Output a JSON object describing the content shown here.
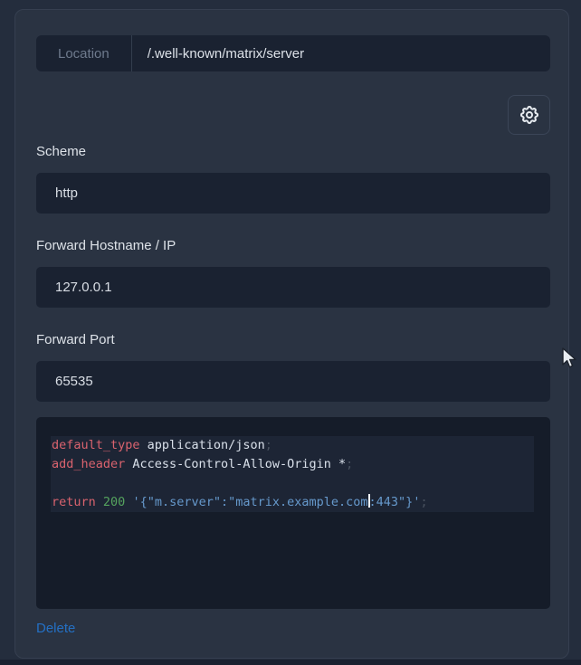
{
  "theme": {
    "page_bg": "#242d3d",
    "card_bg": "#2a3342",
    "input_bg": "#1a2231",
    "link_blue": "#2470c4",
    "code_bg": "#151c29",
    "code_line_bg": "#1d2535",
    "code_keyword_color": "#da636e",
    "code_number_color": "#55a35e",
    "code_string_color": "#6699cc",
    "code_punct_color": "#49525f"
  },
  "location_field": {
    "prefix": "Location",
    "value": "/.well-known/matrix/server"
  },
  "settings_button": {
    "icon": "gear-icon"
  },
  "fields": [
    {
      "label": "Scheme",
      "value": "http"
    },
    {
      "label": "Forward Hostname / IP",
      "value": "127.0.0.1"
    },
    {
      "label": "Forward Port",
      "value": "65535"
    }
  ],
  "code_editor": {
    "lines": [
      {
        "tokens": [
          {
            "t": "keyword",
            "text": "default_type"
          },
          {
            "t": "plain",
            "text": " application/json"
          },
          {
            "t": "punct",
            "text": ";"
          }
        ]
      },
      {
        "tokens": [
          {
            "t": "keyword",
            "text": "add_header"
          },
          {
            "t": "plain",
            "text": " Access-Control-Allow-Origin *"
          },
          {
            "t": "punct",
            "text": ";"
          }
        ]
      },
      {
        "tokens": []
      },
      {
        "tokens": [
          {
            "t": "keyword",
            "text": "return"
          },
          {
            "t": "plain",
            "text": " "
          },
          {
            "t": "number",
            "text": "200"
          },
          {
            "t": "plain",
            "text": " "
          },
          {
            "t": "string",
            "text": "'{\"m.server\":\"matrix.example.com"
          },
          {
            "t": "caret",
            "text": ""
          },
          {
            "t": "string",
            "text": ":443\"}'"
          },
          {
            "t": "punct",
            "text": ";"
          }
        ]
      }
    ]
  },
  "actions": {
    "delete_label": "Delete"
  }
}
